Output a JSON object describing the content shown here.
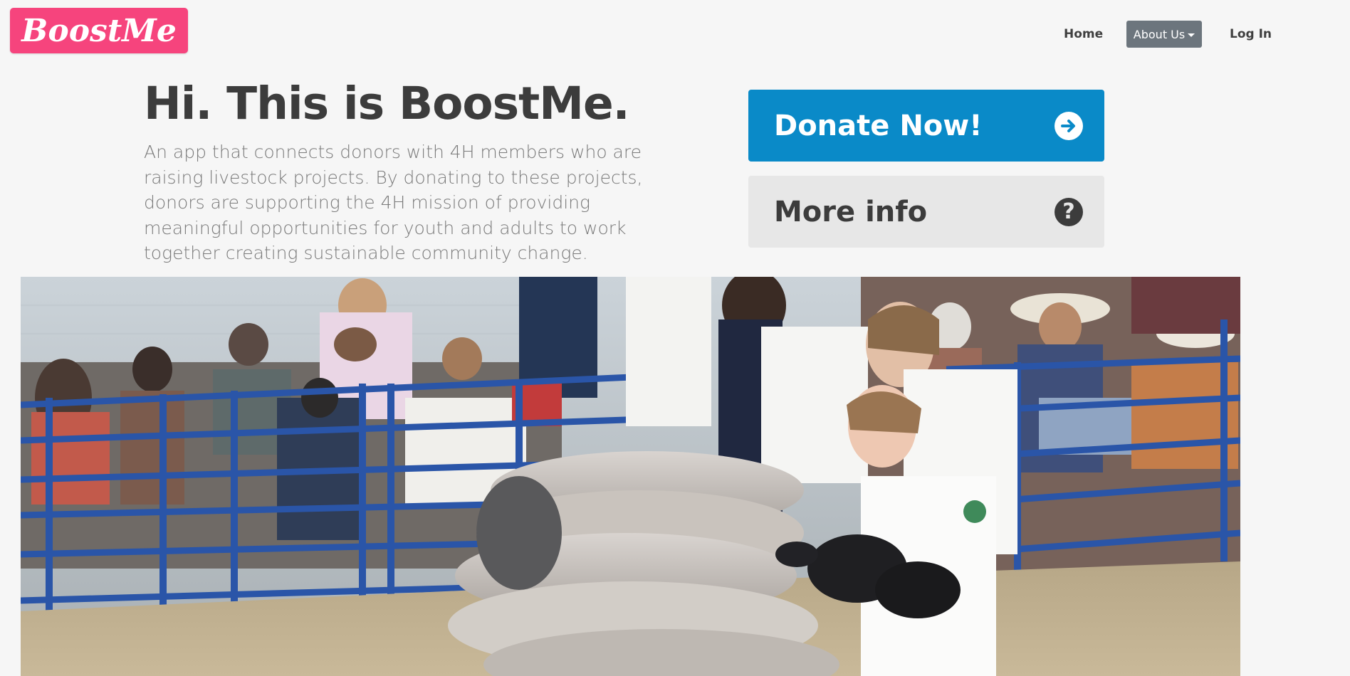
{
  "brand": {
    "name": "BoostMe",
    "logo_text": "BoostMe",
    "color": "#f6447d"
  },
  "nav": {
    "home": "Home",
    "about": "About Us",
    "about_style": "dropdown",
    "login": "Log In"
  },
  "hero": {
    "title": "Hi. This is BoostMe.",
    "description": "An app that connects donors with 4H members who are raising livestock projects. By donating to these projects, donors are supporting the 4H mission of providing meaningful opportunities for youth and adults to work together creating sustainable community change."
  },
  "actions": {
    "donate": {
      "label": "Donate Now!",
      "icon": "arrow-right-circle-icon",
      "color": "#0a8ac8"
    },
    "more_info": {
      "label": "More info",
      "icon": "question-circle-icon",
      "color": "#e7e7e7"
    }
  },
  "photo": {
    "subject": "4H youth showing sheep at livestock show",
    "fence_color": "#2a55a8"
  }
}
